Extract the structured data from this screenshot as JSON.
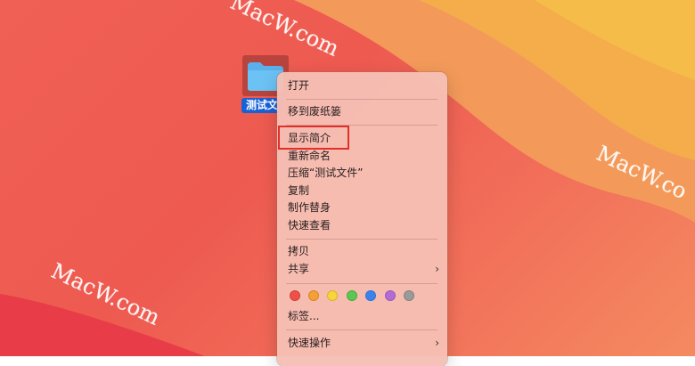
{
  "watermarks": [
    "MacW.com",
    "MacW.com",
    "MacW.co",
    "MacW.com"
  ],
  "folder": {
    "label": "测试文",
    "icon": "folder-icon",
    "label_color": "#1862d8",
    "icon_color": "#5ab0ec"
  },
  "context_menu": {
    "items": [
      {
        "label": "打开"
      },
      {
        "label": "移到废纸篓"
      },
      {
        "label": "显示简介",
        "highlighted": true
      },
      {
        "label": "重新命名"
      },
      {
        "label": "压缩“测试文件”"
      },
      {
        "label": "复制"
      },
      {
        "label": "制作替身"
      },
      {
        "label": "快速查看"
      },
      {
        "label": "拷贝"
      },
      {
        "label": "共享",
        "submenu": true
      },
      {
        "label": "标签..."
      },
      {
        "label": "快速操作",
        "submenu": true
      }
    ],
    "tag_colors": [
      {
        "name": "red",
        "color": "#ef4f47"
      },
      {
        "name": "orange",
        "color": "#f5a034"
      },
      {
        "name": "yellow",
        "color": "#f9d43a"
      },
      {
        "name": "green",
        "color": "#5bc650"
      },
      {
        "name": "blue",
        "color": "#3b84f0"
      },
      {
        "name": "purple",
        "color": "#b46ad8"
      },
      {
        "name": "gray",
        "color": "#9a9a9a"
      }
    ],
    "submenu_glyph": "›",
    "highlight_color": "#e0302a"
  },
  "desktop": {
    "colors": [
      "#ee5a50",
      "#f48a60",
      "#f5a94e"
    ]
  }
}
